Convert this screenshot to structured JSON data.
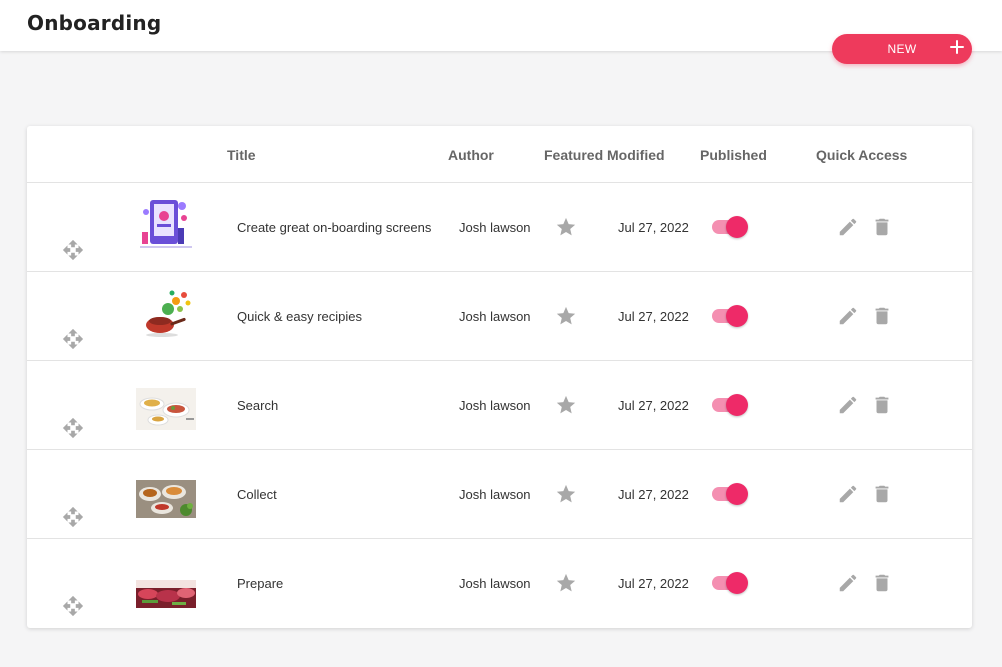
{
  "header": {
    "title": "Onboarding"
  },
  "new_button": {
    "label": "NEW"
  },
  "table": {
    "columns": {
      "title": "Title",
      "author": "Author",
      "featured": "Featured",
      "modified": "Modified",
      "published": "Published",
      "quick_access": "Quick Access"
    },
    "rows": [
      {
        "title": "Create great on-boarding screens",
        "author": "Josh lawson",
        "modified": "Jul 27, 2022",
        "featured": false,
        "published": true
      },
      {
        "title": "Quick & easy recipies",
        "author": "Josh lawson",
        "modified": "Jul 27, 2022",
        "featured": false,
        "published": true
      },
      {
        "title": "Search",
        "author": "Josh lawson",
        "modified": "Jul 27, 2022",
        "featured": false,
        "published": true
      },
      {
        "title": "Collect",
        "author": "Josh lawson",
        "modified": "Jul 27, 2022",
        "featured": false,
        "published": true
      },
      {
        "title": "Prepare",
        "author": "Josh lawson",
        "modified": "Jul 27, 2022",
        "featured": false,
        "published": true
      }
    ]
  },
  "colors": {
    "accent": "#ee3a5c",
    "toggle_track": "#f48fb1",
    "toggle_knob": "#ee2a68",
    "icon_gray": "#a8a8a8"
  },
  "icons": {
    "drag": "move-icon",
    "featured": "star-icon",
    "edit": "pencil-icon",
    "delete": "trash-icon",
    "new": "plus-icon"
  }
}
